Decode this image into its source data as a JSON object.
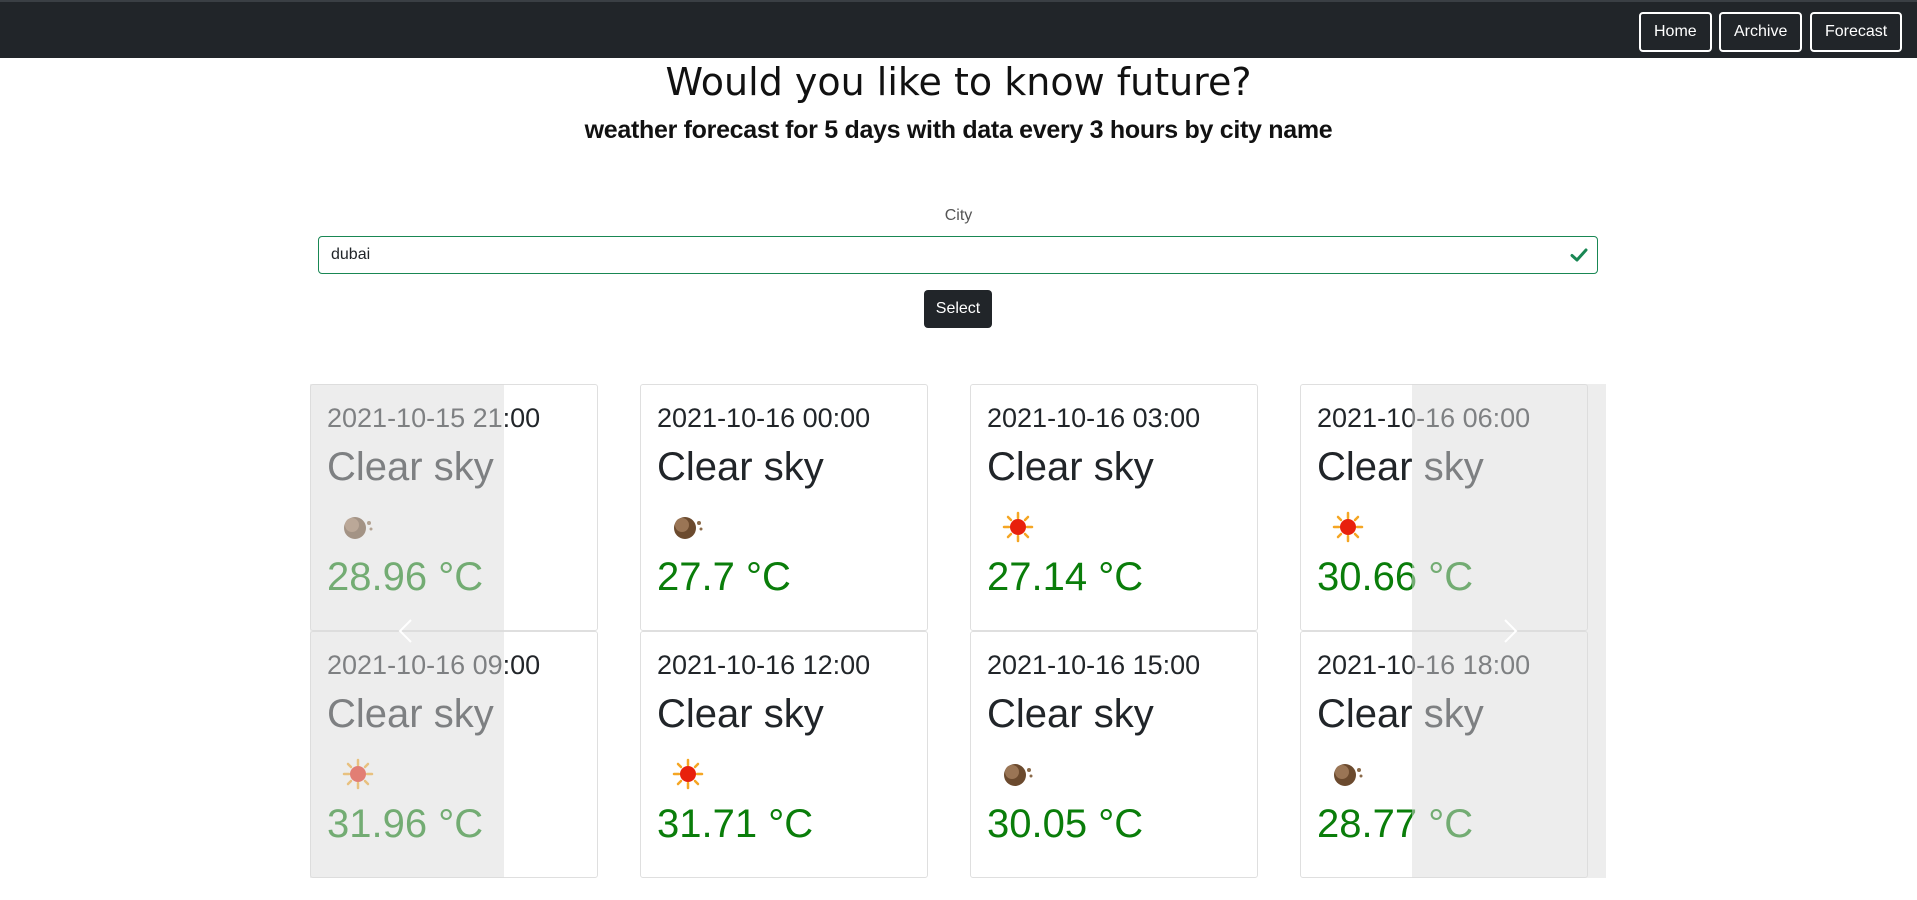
{
  "nav": {
    "home": "Home",
    "archive": "Archive",
    "forecast": "Forecast"
  },
  "header": {
    "title": "Would you like to know future?",
    "subtitle": "weather forecast for 5 days with data every 3 hours by city name"
  },
  "form": {
    "city_label": "City",
    "city_value": "dubai",
    "select_label": "Select"
  },
  "forecast": [
    {
      "date": "2021-10-15 21:00",
      "description": "Clear sky",
      "icon": "moon-icon",
      "temp": "28.96 °C"
    },
    {
      "date": "2021-10-16 00:00",
      "description": "Clear sky",
      "icon": "moon-icon",
      "temp": "27.7 °C"
    },
    {
      "date": "2021-10-16 03:00",
      "description": "Clear sky",
      "icon": "sun-icon",
      "temp": "27.14 °C"
    },
    {
      "date": "2021-10-16 06:00",
      "description": "Clear sky",
      "icon": "sun-icon",
      "temp": "30.66 °C"
    },
    {
      "date": "2021-10-16 09:00",
      "description": "Clear sky",
      "icon": "sun-icon",
      "temp": "31.96 °C"
    },
    {
      "date": "2021-10-16 12:00",
      "description": "Clear sky",
      "icon": "sun-icon",
      "temp": "31.71 °C"
    },
    {
      "date": "2021-10-16 15:00",
      "description": "Clear sky",
      "icon": "moon-icon",
      "temp": "30.05 °C"
    },
    {
      "date": "2021-10-16 18:00",
      "description": "Clear sky",
      "icon": "moon-icon",
      "temp": "28.77 °C"
    }
  ],
  "colors": {
    "navbar": "#212529",
    "temperature": "#0a7d0a",
    "input_border_valid": "#198754"
  }
}
